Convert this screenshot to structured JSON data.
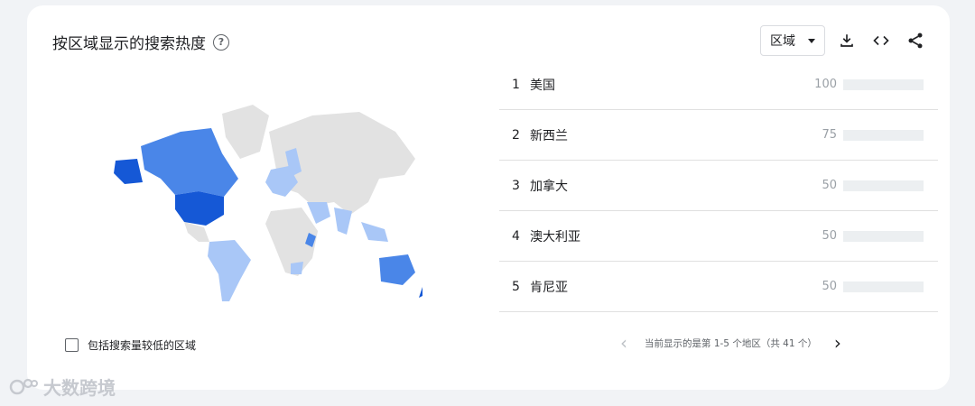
{
  "card": {
    "title": "按区域显示的搜索热度",
    "help_glyph": "?",
    "select_value": "区域"
  },
  "colors": {
    "bar_fill": "#4285f4",
    "bar_track": "#eceff1",
    "map_dark": "#1558d6",
    "map_mid": "#4a86e8",
    "map_light": "#a9c7f7",
    "map_none": "#e2e2e2"
  },
  "ranking": [
    {
      "rank": "1",
      "name": "美国",
      "value": "100"
    },
    {
      "rank": "2",
      "name": "新西兰",
      "value": "75"
    },
    {
      "rank": "3",
      "name": "加拿大",
      "value": "50"
    },
    {
      "rank": "4",
      "name": "澳大利亚",
      "value": "50"
    },
    {
      "rank": "5",
      "name": "肯尼亚",
      "value": "50"
    }
  ],
  "checkbox_label": "包括搜索量较低的区域",
  "pagination": {
    "text": "当前显示的是第 1-5 个地区（共 41 个）",
    "prev_glyph": "‹",
    "next_glyph": "›"
  },
  "watermark": "大数跨境"
}
